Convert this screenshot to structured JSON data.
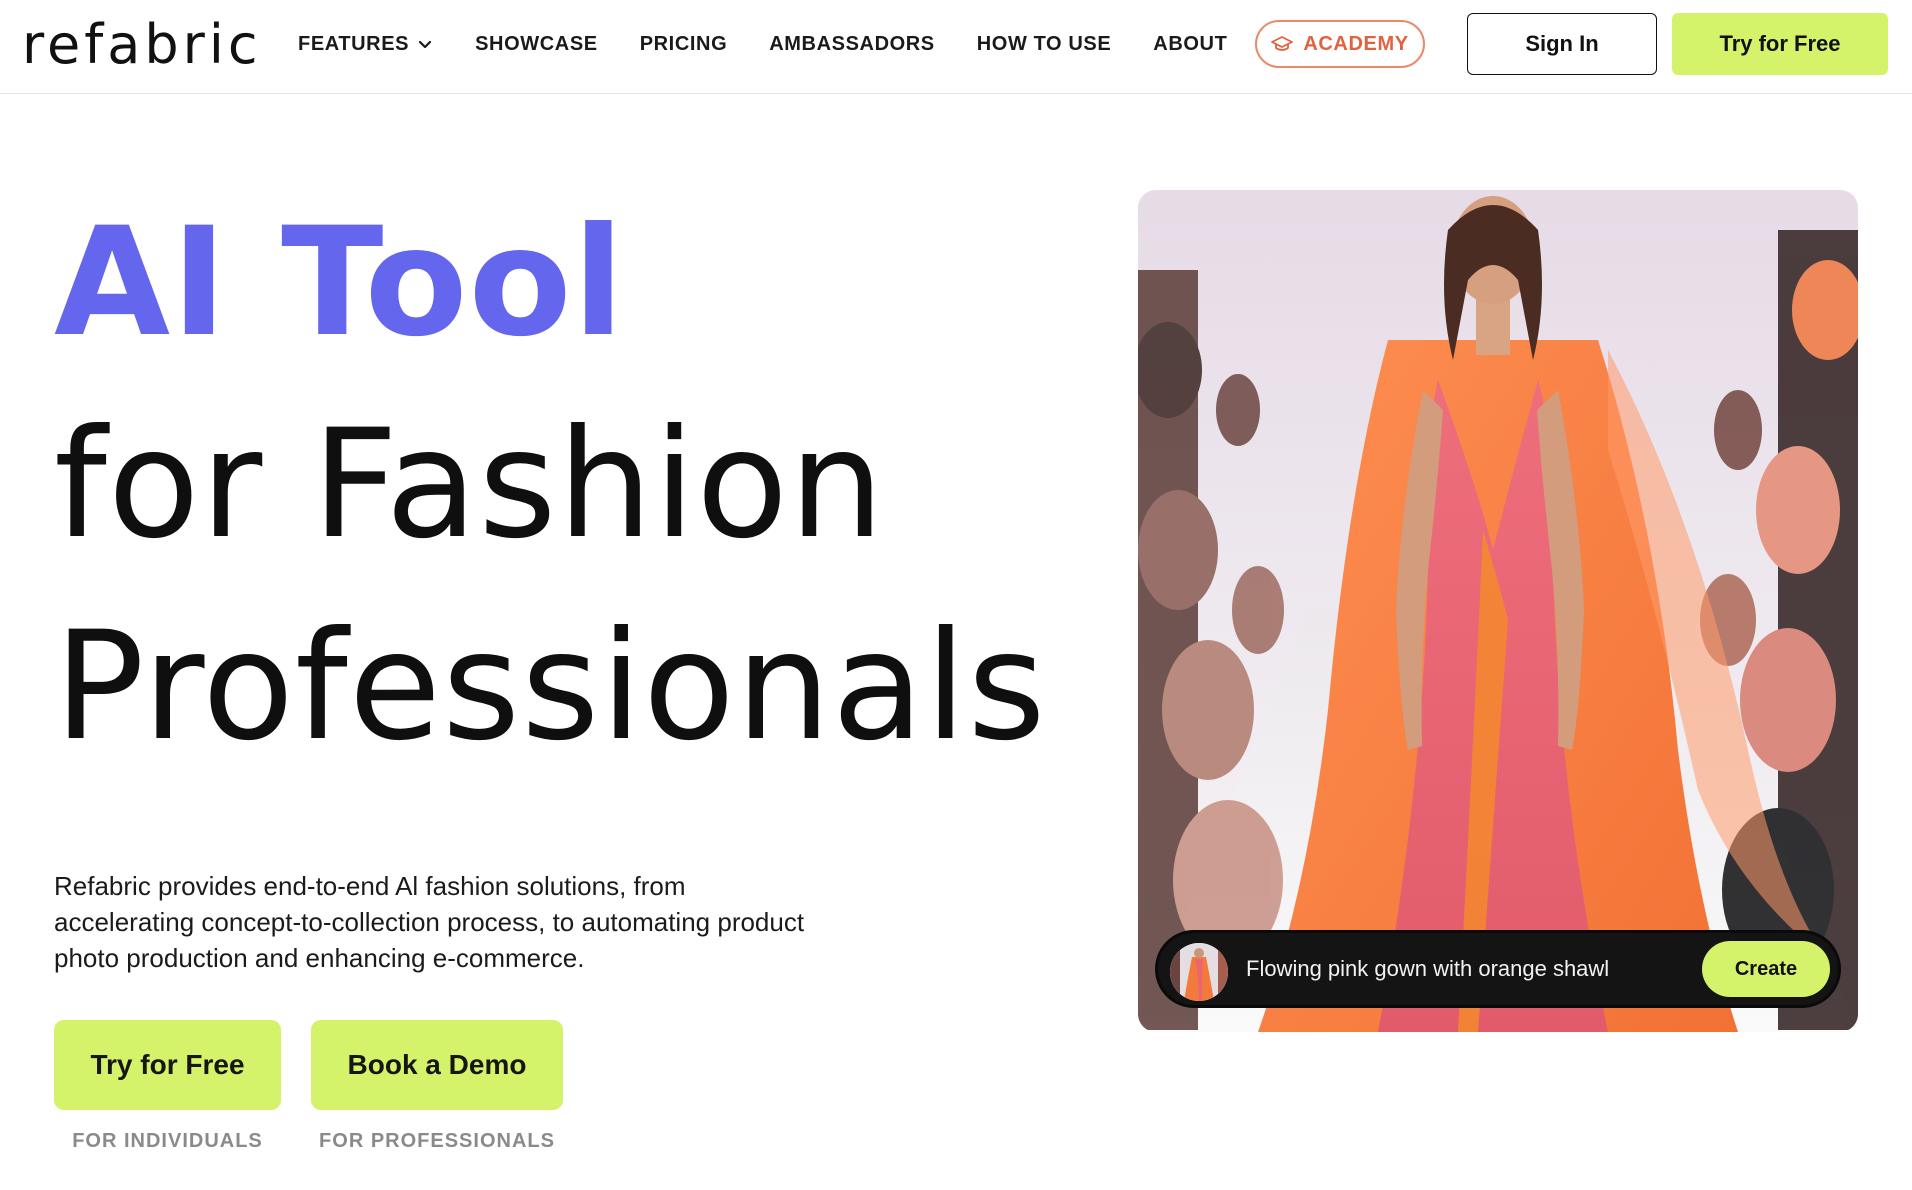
{
  "nav": {
    "logo": "refabric",
    "links": [
      {
        "label": "FEATURES",
        "has_dropdown": true
      },
      {
        "label": "SHOWCASE"
      },
      {
        "label": "PRICING"
      },
      {
        "label": "AMBASSADORS"
      },
      {
        "label": "HOW TO USE"
      },
      {
        "label": "ABOUT"
      }
    ],
    "academy_label": "ACADEMY",
    "sign_in_label": "Sign In",
    "try_label": "Try for Free"
  },
  "hero": {
    "headline_line1": "AI Tool",
    "headline_line2": "for Fashion",
    "headline_line3": "Professionals",
    "description": "Refabric provides end-to-end Al fashion solutions, from accelerating concept-to-collection process, to automating product photo production and enhancing e-commerce.",
    "cta_primary": {
      "label": "Try for Free",
      "sub": "FOR INDIVIDUALS"
    },
    "cta_secondary": {
      "label": "Book a Demo",
      "sub": "FOR PROFESSIONALS"
    }
  },
  "prompt_bar": {
    "text": "Flowing pink gown with orange shawl",
    "button_label": "Create"
  },
  "colors": {
    "accent_purple": "#6566ee",
    "accent_lime": "#d4f26a",
    "academy_orange": "#e2623d"
  }
}
